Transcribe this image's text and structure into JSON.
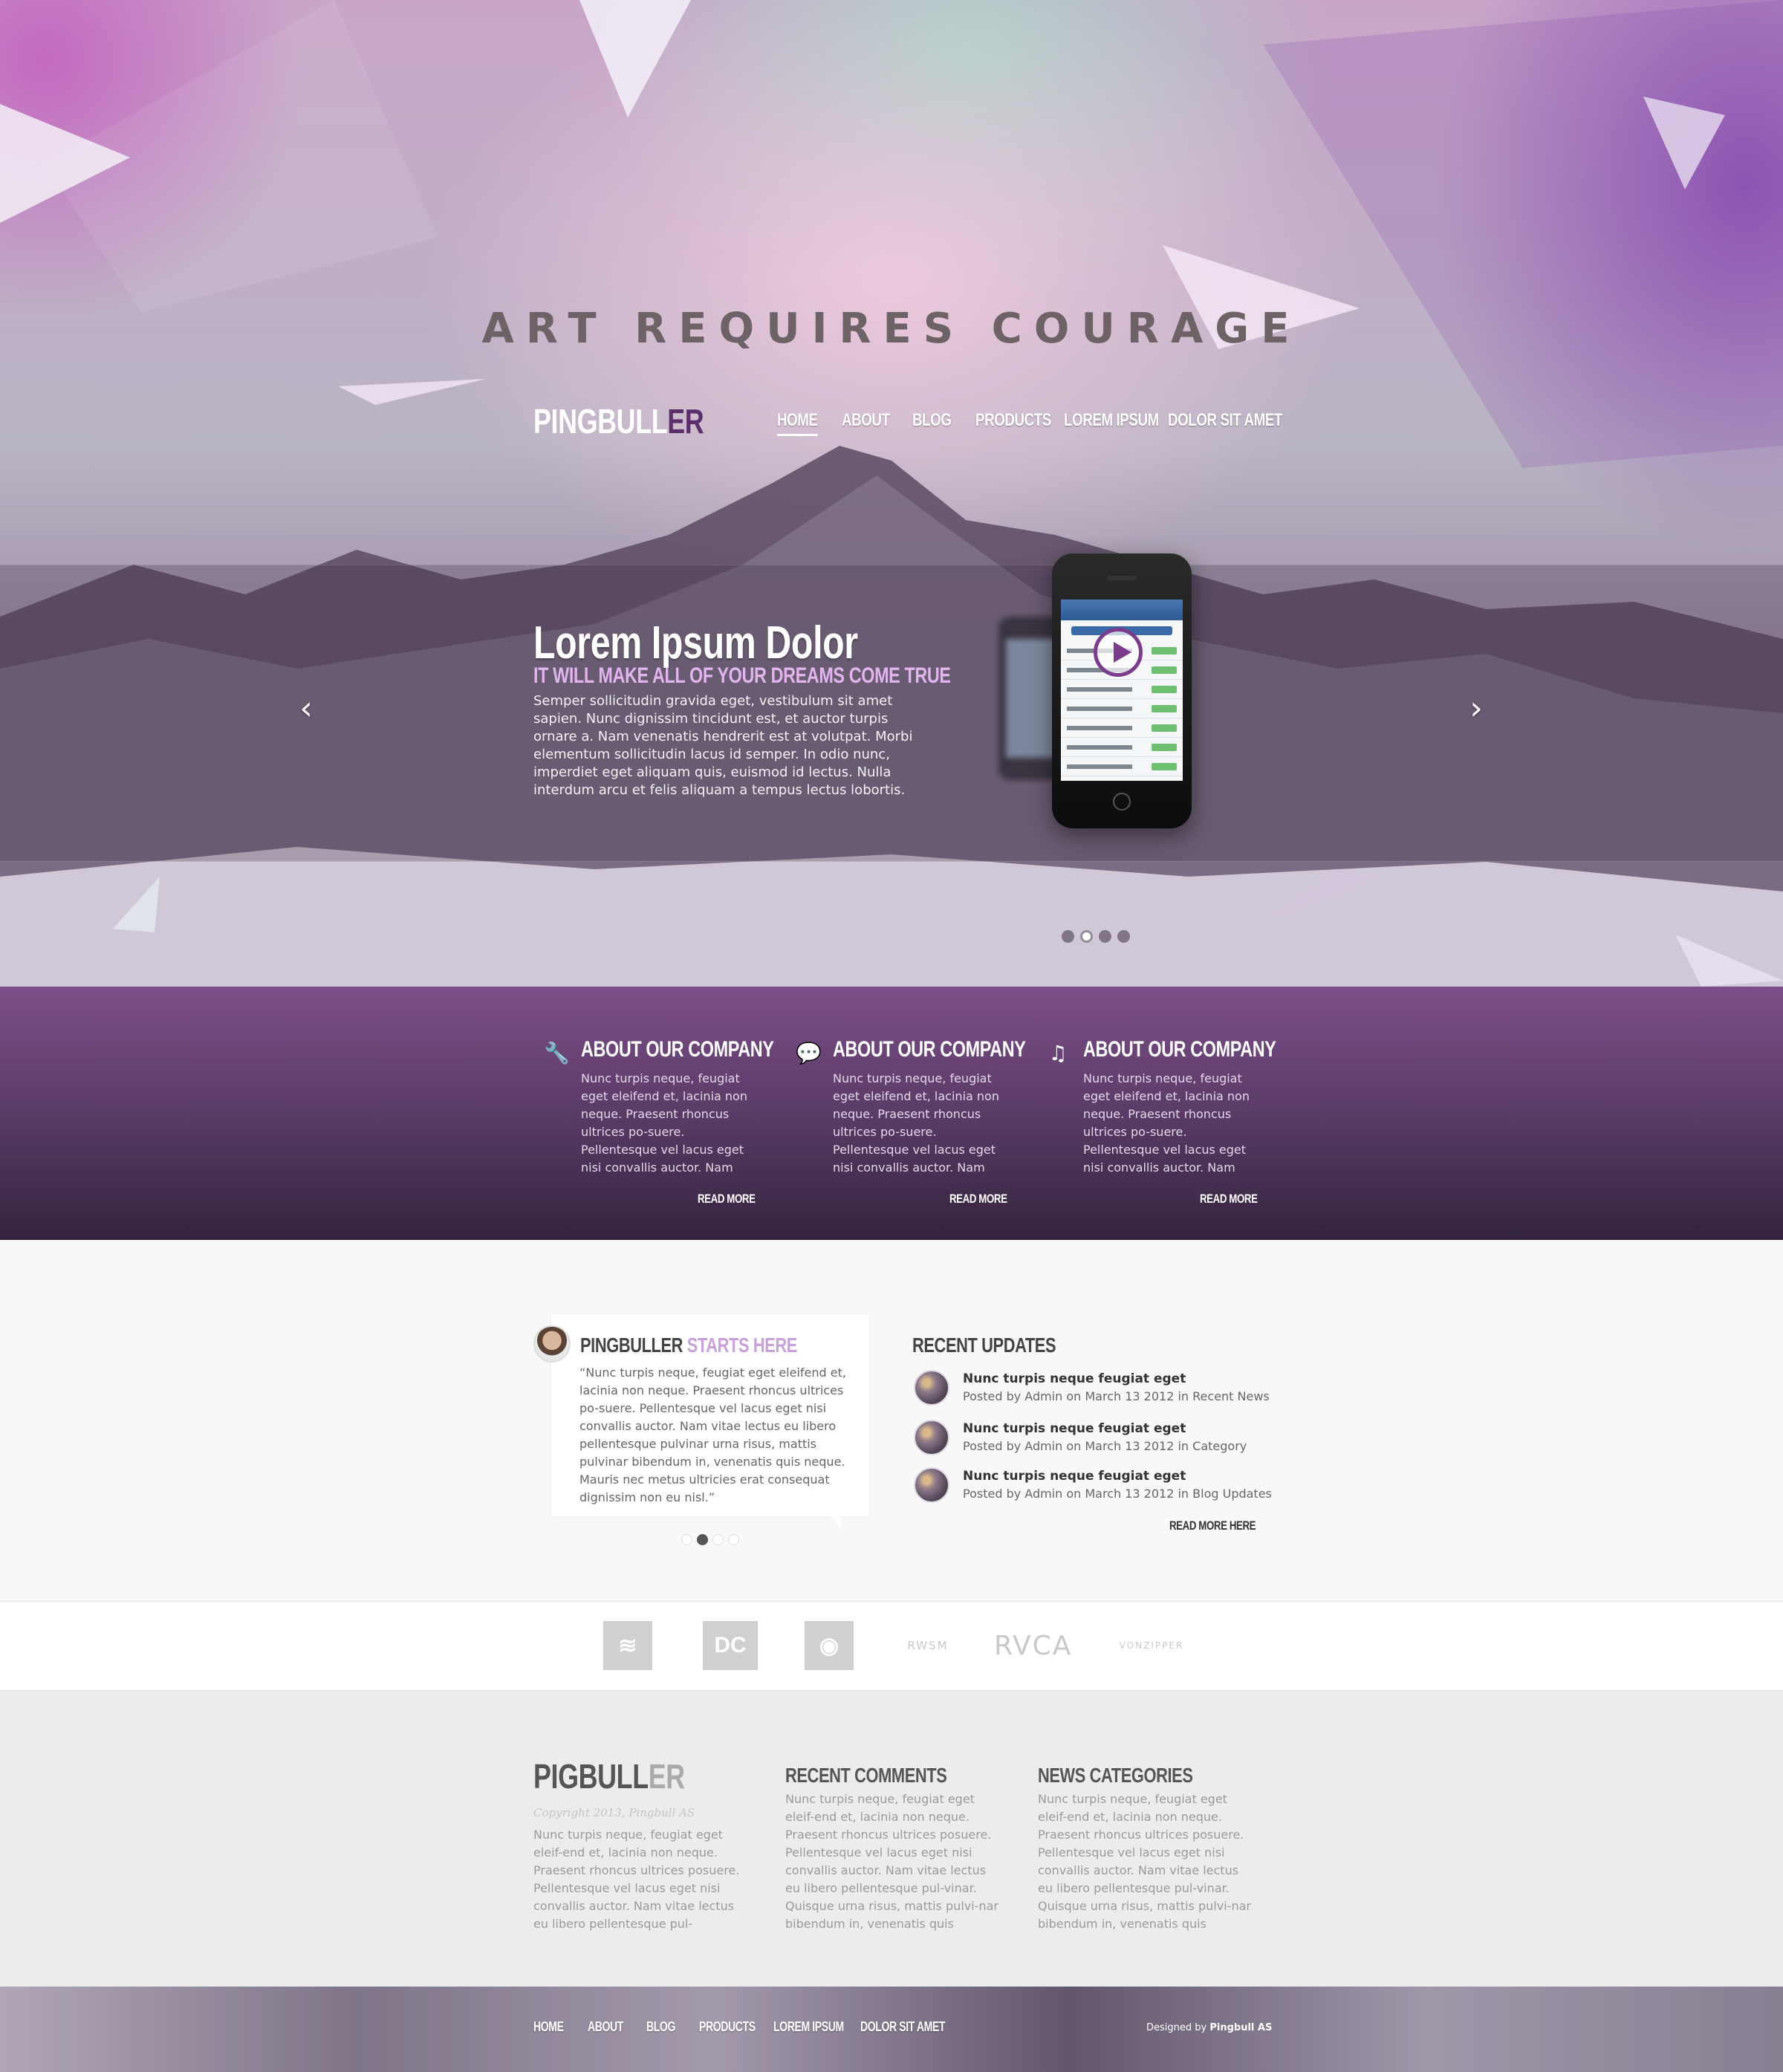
{
  "hero": {
    "tagline": "ART REQUIRES COURAGE",
    "logo_main": "PINGBULL",
    "logo_accent": "ER",
    "nav": [
      "HOME",
      "ABOUT",
      "BLOG",
      "PRODUCTS",
      "LOREM IPSUM",
      "DOLOR SIT AMET"
    ],
    "nav_active": "HOME",
    "slide": {
      "title": "Lorem Ipsum Dolor",
      "subtitle": "IT WILL MAKE ALL OF YOUR DREAMS COME TRUE",
      "text": "Semper sollicitudin gravida eget, vestibulum sit amet sapien. Nunc dignissim tincidunt est, et auctor turpis ornare a. Nam venenatis hendrerit est at volutpat. Morbi elementum sollicitudin lacus id semper. In odio nunc, imperdiet eget aliquam quis, euismod id lectus. Nulla interdum arcu et felis aliquam a tempus lectus lobortis."
    },
    "arrow_prev": "‹",
    "arrow_next": "›",
    "slider_dots": 4,
    "slider_active_index": 1
  },
  "features": [
    {
      "icon": "wrench-icon",
      "glyph": "🔧",
      "title": "ABOUT OUR COMPANY",
      "text": "Nunc turpis neque, feugiat eget eleifend et, lacinia non neque. Praesent rhoncus ultrices po-suere. Pellentesque vel lacus eget nisi convallis auctor. Nam",
      "more": "READ MORE"
    },
    {
      "icon": "speech-bubble-icon",
      "glyph": "💬",
      "title": "ABOUT OUR COMPANY",
      "text": "Nunc turpis neque, feugiat eget eleifend et, lacinia non neque. Praesent rhoncus ultrices po-suere. Pellentesque vel lacus eget nisi convallis auctor. Nam",
      "more": "READ MORE"
    },
    {
      "icon": "music-note-icon",
      "glyph": "♫",
      "title": "ABOUT OUR COMPANY",
      "text": "Nunc turpis neque, feugiat eget eleifend et, lacinia non neque. Praesent rhoncus ultrices po-suere. Pellentesque vel lacus eget nisi convallis auctor. Nam",
      "more": "READ MORE"
    }
  ],
  "testimonial": {
    "head_main": "PINGBULLER",
    "head_accent": "STARTS HERE",
    "text": "“Nunc turpis neque, feugiat eget eleifend et, lacinia non neque. Praesent rhoncus ultrices po-suere. Pellentesque vel lacus eget nisi convallis auctor. Nam vitae lectus eu libero pellentesque pulvinar urna risus, mattis pulvinar bibendum in, venenatis quis neque. Mauris nec metus ultricies erat consequat dignissim non eu nisl.”",
    "dots": 4,
    "active_index": 1
  },
  "recent_updates": {
    "title": "RECENT UPDATES",
    "items": [
      {
        "title": "Nunc turpis neque feugiat eget",
        "meta": "Posted by Admin on March 13 2012 in Recent News"
      },
      {
        "title": "Nunc turpis neque feugiat eget",
        "meta": "Posted by Admin on March 13 2012 in Category"
      },
      {
        "title": "Nunc turpis neque feugiat eget",
        "meta": "Posted by Admin on March 13 2012 in Blog Updates"
      }
    ],
    "more": "READ MORE HERE"
  },
  "brands": [
    {
      "name": "billabong-logo",
      "label": "≋"
    },
    {
      "name": "dc-logo",
      "label": "DC"
    },
    {
      "name": "element-logo",
      "label": "◉"
    },
    {
      "name": "rwsm-logo",
      "label": "RWSM"
    },
    {
      "name": "rvca-logo",
      "label": "RVCA"
    },
    {
      "name": "vonzipper-logo",
      "label": "VONZIPPER"
    }
  ],
  "footer": {
    "logo_main": "PIGBULL",
    "logo_accent": "ER",
    "copyright": "Copyright 2013, Pingbull AS",
    "about_text": "Nunc turpis neque, feugiat eget eleif-end et, lacinia non neque. Praesent rhoncus ultrices posuere. Pellentesque vel lacus eget nisi convallis auctor. Nam vitae lectus eu libero pellentesque pul-",
    "comments_title": "RECENT COMMENTS",
    "comments_text": "Nunc turpis neque, feugiat eget eleif-end et, lacinia non neque. Praesent rhoncus ultrices posuere. Pellentesque vel lacus eget nisi convallis auctor. Nam vitae lectus eu libero pellentesque pul-vinar. Quisque urna risus, mattis pulvi-nar bibendum in, venenatis quis",
    "categories_title": "NEWS CATEGORIES",
    "categories_text": "Nunc turpis neque, feugiat eget eleif-end et, lacinia non neque. Praesent rhoncus ultrices posuere. Pellentesque vel lacus eget nisi convallis auctor. Nam vitae lectus eu libero pellentesque pul-vinar. Quisque urna risus, mattis pulvi-nar bibendum in, venenatis quis"
  },
  "bottom_nav": [
    "HOME",
    "ABOUT",
    "BLOG",
    "PRODUCTS",
    "LOREM IPSUM",
    "DOLOR SIT AMET"
  ],
  "credit": {
    "prefix": "Designed by",
    "name": "Pingbull AS"
  },
  "colors": {
    "accent_purple": "#7b3c8b",
    "accent_lilac": "#c9a0dc",
    "features_top": "#7d4f8a",
    "features_bottom": "#33243e"
  }
}
